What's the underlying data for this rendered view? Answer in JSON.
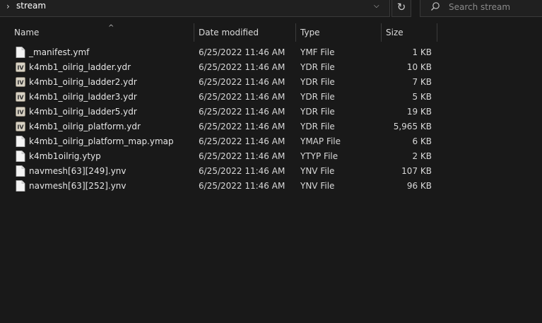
{
  "address": {
    "current_folder": "stream"
  },
  "search": {
    "placeholder": "Search stream"
  },
  "columns": {
    "name": "Name",
    "date": "Date modified",
    "type": "Type",
    "size": "Size"
  },
  "files": [
    {
      "name": "_manifest.ymf",
      "date": "6/25/2022 11:46 AM",
      "type": "YMF File",
      "size": "1 KB",
      "icon": "document-icon"
    },
    {
      "name": "k4mb1_oilrig_ladder.ydr",
      "date": "6/25/2022 11:46 AM",
      "type": "YDR File",
      "size": "10 KB",
      "icon": "openiv-icon"
    },
    {
      "name": "k4mb1_oilrig_ladder2.ydr",
      "date": "6/25/2022 11:46 AM",
      "type": "YDR File",
      "size": "7 KB",
      "icon": "openiv-icon"
    },
    {
      "name": "k4mb1_oilrig_ladder3.ydr",
      "date": "6/25/2022 11:46 AM",
      "type": "YDR File",
      "size": "5 KB",
      "icon": "openiv-icon"
    },
    {
      "name": "k4mb1_oilrig_ladder5.ydr",
      "date": "6/25/2022 11:46 AM",
      "type": "YDR File",
      "size": "19 KB",
      "icon": "openiv-icon"
    },
    {
      "name": "k4mb1_oilrig_platform.ydr",
      "date": "6/25/2022 11:46 AM",
      "type": "YDR File",
      "size": "5,965 KB",
      "icon": "openiv-icon"
    },
    {
      "name": "k4mb1_oilrig_platform_map.ymap",
      "date": "6/25/2022 11:46 AM",
      "type": "YMAP File",
      "size": "6 KB",
      "icon": "document-icon"
    },
    {
      "name": "k4mb1oilrig.ytyp",
      "date": "6/25/2022 11:46 AM",
      "type": "YTYP File",
      "size": "2 KB",
      "icon": "document-icon"
    },
    {
      "name": "navmesh[63][249].ynv",
      "date": "6/25/2022 11:46 AM",
      "type": "YNV File",
      "size": "107 KB",
      "icon": "document-icon"
    },
    {
      "name": "navmesh[63][252].ynv",
      "date": "6/25/2022 11:46 AM",
      "type": "YNV File",
      "size": "96 KB",
      "icon": "document-icon"
    }
  ]
}
